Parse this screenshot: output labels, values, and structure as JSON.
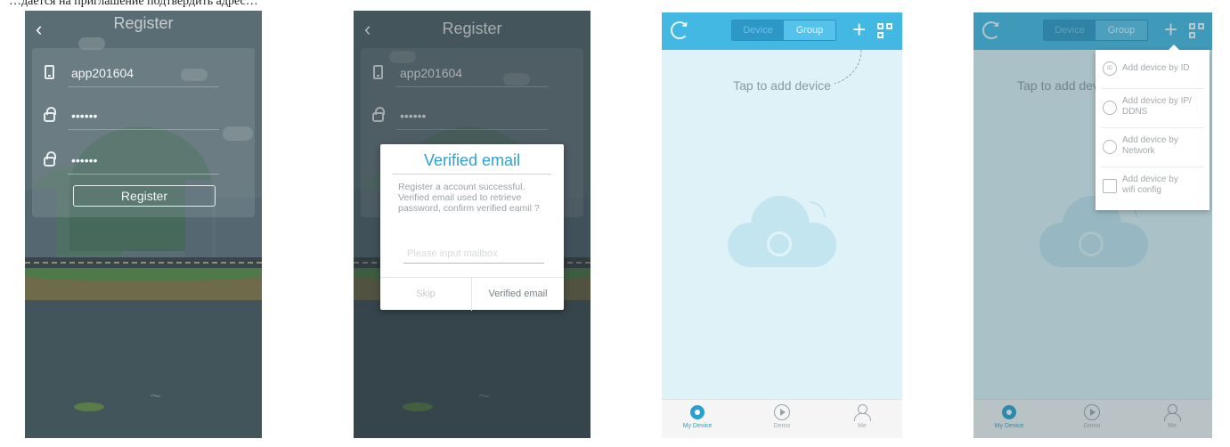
{
  "top_caption": "…дается на приглашение подтвердить адрес…",
  "screen1": {
    "title": "Register",
    "username": "app201604",
    "password": "••••••",
    "confirm_password": "••••••",
    "register_button": "Register"
  },
  "screen2": {
    "title": "Register",
    "username": "app201604",
    "password": "••••••",
    "dialog": {
      "title": "Verified email",
      "message": "Register a account successful. Verified email used to retrieve password, confirm verified eamil ?",
      "input_placeholder": "Please input mailbox",
      "skip": "Skip",
      "verify": "Verified email"
    }
  },
  "screen3": {
    "tabs": [
      "Device",
      "Group"
    ],
    "tap_text": "Tap to add device",
    "bottom_tabs": [
      "My Device",
      "Demo",
      "Me"
    ]
  },
  "screen4": {
    "tabs": [
      "Device",
      "Group"
    ],
    "tap_text": "Tap to add device",
    "menu_items": [
      {
        "icon": "ID",
        "label": "Add device by ID"
      },
      {
        "icon": "",
        "label": "Add device by IP/ DDNS"
      },
      {
        "icon": "",
        "label": "Add device by Network"
      },
      {
        "icon": "",
        "label": "Add device by wifi config"
      }
    ],
    "bottom_tabs": [
      "My Device",
      "Demo",
      "Me"
    ]
  },
  "colors": {
    "accent": "#42b8e3",
    "dialog_title": "#2aa3d4",
    "scene_background": "#4d5f67"
  }
}
